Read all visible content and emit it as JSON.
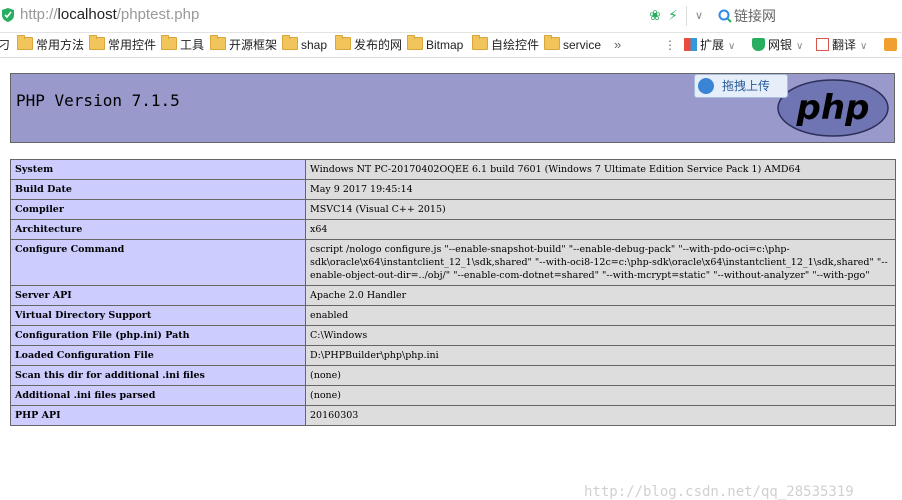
{
  "address_bar": {
    "url_scheme": "http://",
    "url_host": "localhost",
    "url_path": "/phptest.php",
    "search_label": "链接网"
  },
  "bookmarks": [
    {
      "label": "刁",
      "folder": false
    },
    {
      "label": "常用方法",
      "folder": true
    },
    {
      "label": "常用控件",
      "folder": true
    },
    {
      "label": "工具",
      "folder": true
    },
    {
      "label": "开源框架",
      "folder": true
    },
    {
      "label": "shap",
      "folder": true
    },
    {
      "label": "发布的网",
      "folder": true
    },
    {
      "label": "Bitmap",
      "folder": true
    },
    {
      "label": "自绘控件",
      "folder": true
    },
    {
      "label": "service",
      "folder": true
    }
  ],
  "bookmark_overflow": "»",
  "extensions": {
    "expand": "扩展",
    "netbank": "网银",
    "translate": "翻译"
  },
  "page": {
    "version_title": "PHP Version 7.1.5",
    "upload_button": "拖拽上传",
    "logo_text": "php",
    "rows": [
      {
        "key": "System",
        "value": "Windows NT PC-20170402OQEE 6.1 build 7601 (Windows 7 Ultimate Edition Service Pack 1) AMD64"
      },
      {
        "key": "Build Date",
        "value": "May 9 2017 19:45:14"
      },
      {
        "key": "Compiler",
        "value": "MSVC14 (Visual C++ 2015)"
      },
      {
        "key": "Architecture",
        "value": "x64"
      },
      {
        "key": "Configure Command",
        "value": "cscript /nologo configure.js \"--enable-snapshot-build\" \"--enable-debug-pack\" \"--with-pdo-oci=c:\\php-sdk\\oracle\\x64\\instantclient_12_1\\sdk,shared\" \"--with-oci8-12c=c:\\php-sdk\\oracle\\x64\\instantclient_12_1\\sdk,shared\" \"--enable-object-out-dir=../obj/\" \"--enable-com-dotnet=shared\" \"--with-mcrypt=static\" \"--without-analyzer\" \"--with-pgo\""
      },
      {
        "key": "Server API",
        "value": "Apache 2.0 Handler"
      },
      {
        "key": "Virtual Directory Support",
        "value": "enabled"
      },
      {
        "key": "Configuration File (php.ini) Path",
        "value": "C:\\Windows"
      },
      {
        "key": "Loaded Configuration File",
        "value": "D:\\PHPBuilder\\php\\php.ini"
      },
      {
        "key": "Scan this dir for additional .ini files",
        "value": "(none)"
      },
      {
        "key": "Additional .ini files parsed",
        "value": "(none)"
      },
      {
        "key": "PHP API",
        "value": "20160303"
      }
    ],
    "watermark": "http://blog.csdn.net/qq_28535319"
  },
  "colors": {
    "header_bg": "#9999cc",
    "key_bg": "#ccccff",
    "value_bg": "#dddddd"
  }
}
